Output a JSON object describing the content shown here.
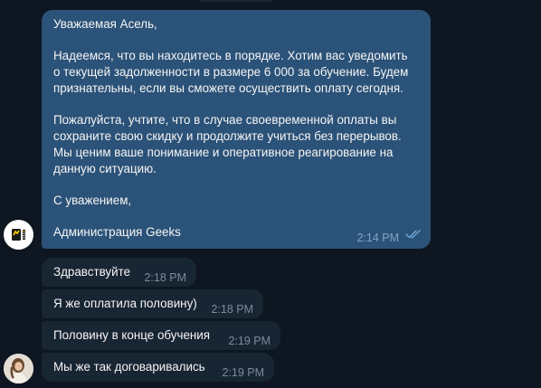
{
  "outgoing": {
    "greeting": "Уважаемая Асель,",
    "para1_lines": [
      "Надеемся, что вы находитесь в порядке. Хотим вас уведомить",
      "о текущей задолженности в размере 6 000 за обучение. Будем",
      "признательны, если вы сможете осуществить оплату сегодня."
    ],
    "para2_lines": [
      "Пожалуйста, учтите, что в случае своевременной оплаты вы",
      "сохраните свою скидку и продолжите учиться без перерывов.",
      "Мы ценим ваше понимание и оперативное реагирование на",
      "данную ситуацию."
    ],
    "closing": "С уважением,",
    "signature": "Администрация Geeks",
    "time": "2:14 PM",
    "status_icon": "double-check-icon"
  },
  "incoming": [
    {
      "text": "Здравствуйте",
      "time": "2:18 PM"
    },
    {
      "text": "Я же оплатила половину)",
      "time": "2:18 PM"
    },
    {
      "text": "Половину в конце обучения",
      "time": "2:19 PM"
    },
    {
      "text": "Мы же так договаривались",
      "time": "2:19 PM"
    }
  ],
  "avatars": {
    "sender_logo": "geeks-logo-icon",
    "user": "user-avatar"
  },
  "colors": {
    "background": "#0e1621",
    "outgoing_bubble": "#2b5278",
    "incoming_bubble": "#182533",
    "text": "#f5f5f5",
    "time": "#7d8b99",
    "check": "#6ea6d8"
  }
}
